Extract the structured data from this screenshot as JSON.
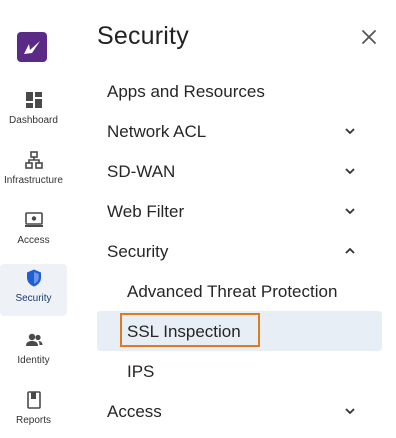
{
  "rail": {
    "items": [
      {
        "label": "Dashboard",
        "icon": "dashboard-icon"
      },
      {
        "label": "Infrastructure",
        "icon": "infrastructure-icon"
      },
      {
        "label": "Access",
        "icon": "access-icon"
      },
      {
        "label": "Security",
        "icon": "shield-icon",
        "active": true
      },
      {
        "label": "Identity",
        "icon": "identity-icon"
      },
      {
        "label": "Reports",
        "icon": "reports-icon"
      }
    ]
  },
  "panel": {
    "title": "Security",
    "close_icon": "close-icon",
    "items": [
      {
        "label": "Apps and Resources"
      },
      {
        "label": "Network ACL",
        "chevron": "down"
      },
      {
        "label": "SD-WAN",
        "chevron": "down"
      },
      {
        "label": "Web Filter",
        "chevron": "down"
      },
      {
        "label": "Security",
        "chevron": "up"
      },
      {
        "label": "Advanced Threat Protection"
      },
      {
        "label": "SSL Inspection",
        "selected": true
      },
      {
        "label": "IPS"
      },
      {
        "label": "Access",
        "chevron": "down"
      }
    ]
  },
  "colors": {
    "brand": "#5b2a86",
    "active_icon": "#1f5fd6",
    "selected_bg": "#e8eef6",
    "highlight": "#e07a1f"
  }
}
